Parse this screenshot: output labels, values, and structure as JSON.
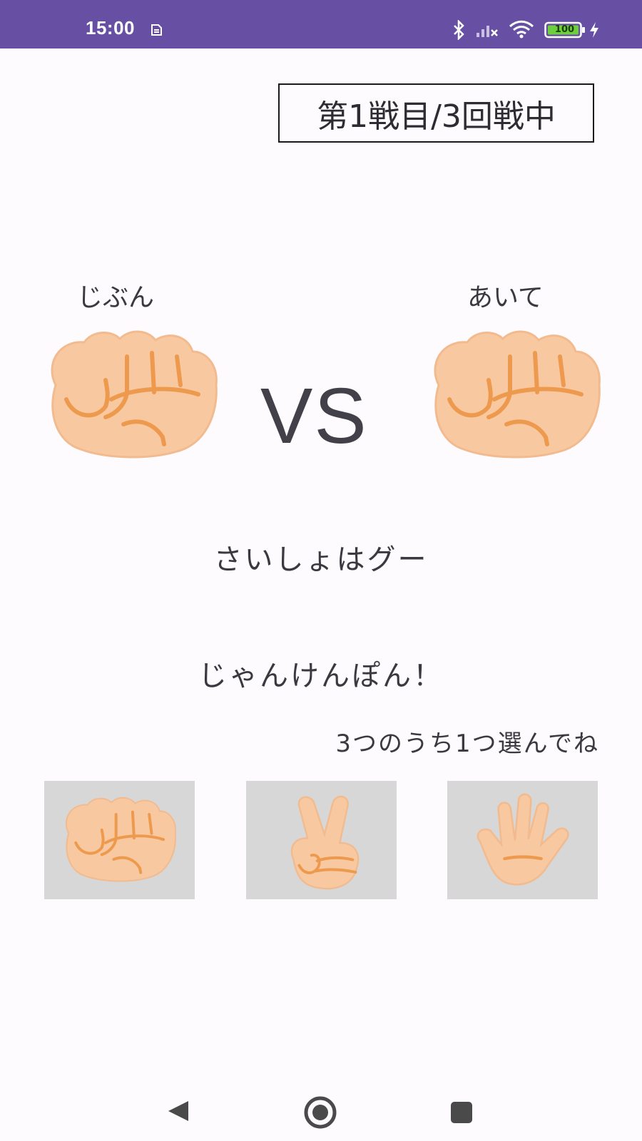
{
  "status_bar": {
    "time": "15:00",
    "battery": "100",
    "icons": [
      "sim-card-icon",
      "bluetooth-icon",
      "signal-off-icon",
      "wifi-icon",
      "battery-icon",
      "charging-icon"
    ]
  },
  "game": {
    "round_indicator": "第1戦目/3回戦中",
    "player_label": "じぶん",
    "opponent_label": "あいて",
    "player_hand": "rock",
    "opponent_hand": "rock",
    "vs_label": "VS",
    "message_1": "さいしょはグー",
    "message_2": "じゃんけんぽん！",
    "instruction": "3つのうち1つ選んでね",
    "choices": [
      {
        "hand": "rock",
        "icon": "rock-hand-icon"
      },
      {
        "hand": "scissors",
        "icon": "scissors-hand-icon"
      },
      {
        "hand": "paper",
        "icon": "paper-hand-icon"
      }
    ]
  },
  "navigation": {
    "buttons": [
      "back-icon",
      "home-icon",
      "recents-icon"
    ]
  },
  "colors": {
    "status_bar": "#6750a4",
    "background": "#fefbfe",
    "skin": "#f8c9a0",
    "skin_line": "#ee9a4e",
    "choice_bg": "#d6d7d6"
  }
}
